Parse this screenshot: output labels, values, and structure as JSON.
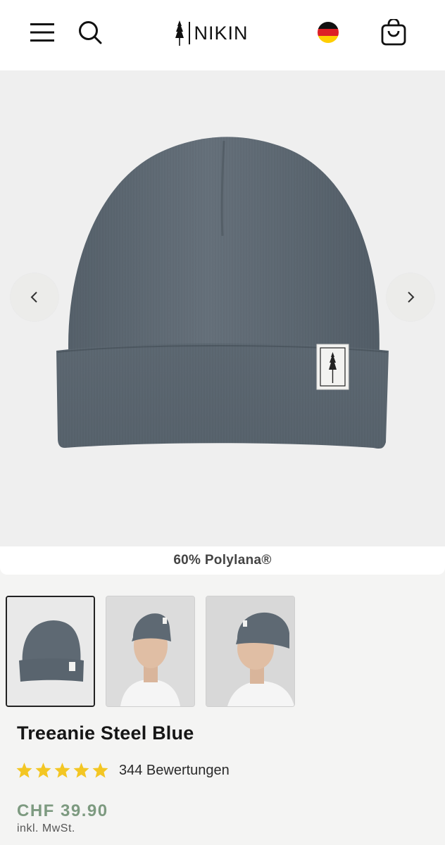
{
  "header": {
    "brand": "NIKIN",
    "menu_icon": "hamburger-menu-icon",
    "search_icon": "search-icon",
    "language_icon": "german-flag-icon",
    "cart_icon": "shopping-bag-icon"
  },
  "gallery": {
    "prev_icon": "chevron-left-icon",
    "next_icon": "chevron-right-icon",
    "material_label": "60% Polylana®",
    "thumbnails": [
      "beanie-front",
      "model-front",
      "model-side"
    ],
    "active_thumbnail": 0
  },
  "product": {
    "title": "Treeanie Steel Blue",
    "rating_stars": 5,
    "reviews_label": "344 Bewertungen",
    "price": "CHF 39.90",
    "tax_note": "inkl. MwSt."
  },
  "colors": {
    "beanie": "#5d6872",
    "price_green": "#7d9a80",
    "star_yellow": "#f3c623",
    "background": "#f4f4f3"
  }
}
